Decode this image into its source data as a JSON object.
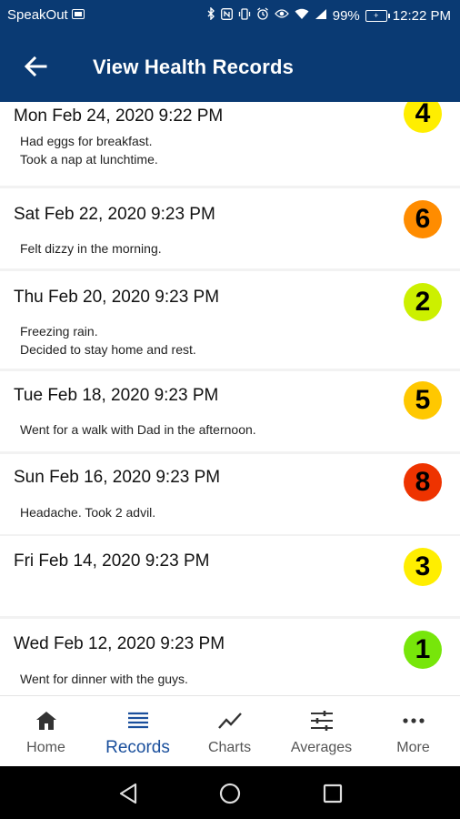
{
  "status_bar": {
    "carrier": "SpeakOut",
    "battery": "99%",
    "time": "12:22 PM",
    "icons": [
      "sim-icon",
      "bluetooth-icon",
      "nfc-icon",
      "vibrate-icon",
      "alarm-icon",
      "eye-icon",
      "wifi-icon",
      "signal-icon",
      "battery-icon"
    ]
  },
  "app_bar": {
    "title": "View Health Records",
    "back_icon": "arrow-left-icon"
  },
  "colors": {
    "primary": "#0a3a73",
    "accent": "#1a4f9c",
    "badge_yellow": "#ffee00",
    "badge_orange": "#ff8c00",
    "badge_lime": "#ccf000",
    "badge_gold": "#ffc800",
    "badge_red": "#ee3300",
    "badge_green": "#77e60a"
  },
  "records": [
    {
      "date": "Mon Feb 24, 2020 9:22 PM",
      "notes": "Had eggs for breakfast.\nTook a nap at lunchtime.",
      "score": "4",
      "color": "#ffee00"
    },
    {
      "date": "Sat Feb 22, 2020 9:23 PM",
      "notes": "Felt dizzy in the morning.",
      "score": "6",
      "color": "#ff8c00"
    },
    {
      "date": "Thu Feb 20, 2020 9:23 PM",
      "notes": "Freezing rain.\nDecided to stay home and rest.",
      "score": "2",
      "color": "#ccf000"
    },
    {
      "date": "Tue Feb 18, 2020 9:23 PM",
      "notes": "Went for a walk with Dad in the afternoon.",
      "score": "5",
      "color": "#ffc800"
    },
    {
      "date": "Sun Feb 16, 2020 9:23 PM",
      "notes": "Headache.  Took 2 advil.",
      "score": "8",
      "color": "#ee3300"
    },
    {
      "date": "Fri Feb 14, 2020 9:23 PM",
      "notes": "",
      "score": "3",
      "color": "#ffee00"
    },
    {
      "date": "Wed Feb 12, 2020 9:23 PM",
      "notes": "Went for dinner with the guys.",
      "score": "1",
      "color": "#77e60a"
    }
  ],
  "bottom_nav": [
    {
      "label": "Home",
      "icon": "home-icon",
      "active": false
    },
    {
      "label": "Records",
      "icon": "list-icon",
      "active": true
    },
    {
      "label": "Charts",
      "icon": "line-chart-icon",
      "active": false
    },
    {
      "label": "Averages",
      "icon": "sliders-icon",
      "active": false
    },
    {
      "label": "More",
      "icon": "more-dots-icon",
      "active": false
    }
  ],
  "system_nav": [
    "back-triangle-icon",
    "home-circle-icon",
    "recents-square-icon"
  ]
}
